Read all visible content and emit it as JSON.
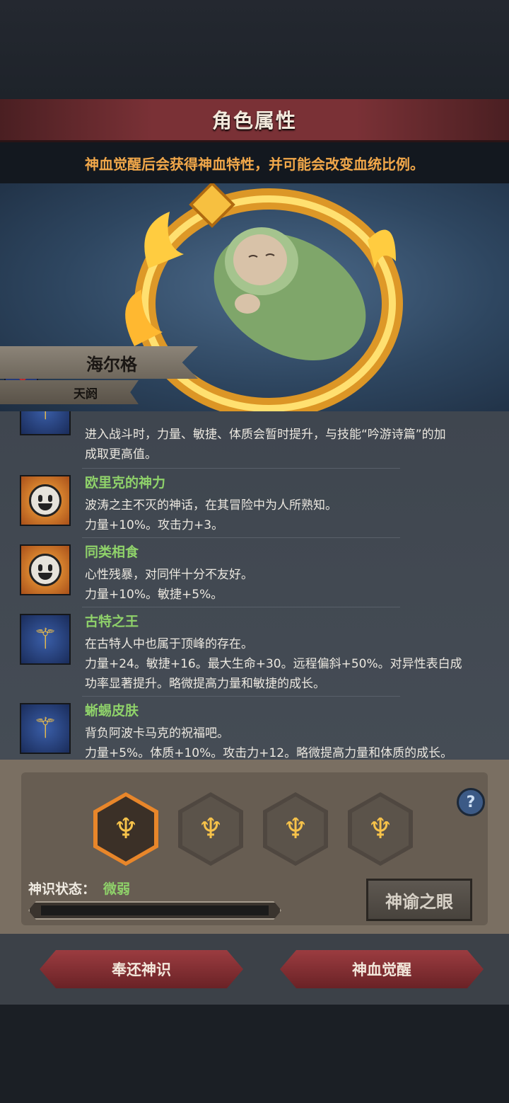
{
  "title": "角色属性",
  "hint": "神血觉醒后会获得神血特性，并可能会改变血统比例。",
  "character": {
    "name": "海尔格",
    "trait_title": "天阏"
  },
  "traits": [
    {
      "name": "",
      "icon": "axe-icon",
      "lines": [
        "进入战斗时，力量、敏捷、体质会暂时提升，与技能“吟游诗篇”的加",
        "成取更高值。"
      ]
    },
    {
      "name": "欧里克的神力",
      "icon": "smiley-face-icon",
      "lines": [
        "波涛之主不灭的神话，在其冒险中为人所熟知。",
        "力量+10%。攻击力+3。"
      ]
    },
    {
      "name": "同类相食",
      "icon": "smiley-face-icon",
      "lines": [
        "心性残暴，对同伴十分不友好。",
        "力量+10%。敏捷+5%。"
      ]
    },
    {
      "name": "古特之王",
      "icon": "axe-icon",
      "lines": [
        "在古特人中也属于顶峰的存在。",
        "力量+24。敏捷+16。最大生命+30。远程偏斜+50%。对异性表白成",
        "功率显著提升。略微提高力量和敏捷的成长。"
      ]
    },
    {
      "name": "蜥蜴皮肤",
      "icon": "axe-icon",
      "lines": [
        "背负阿波卡马克的祝福吧。",
        "力量+5%。体质+10%。攻击力+12。略微提高力量和体质的成长。"
      ]
    }
  ],
  "slots": [
    {
      "state": "active",
      "icon": "flame-trident-icon"
    },
    {
      "state": "inactive",
      "icon": "flame-trident-icon"
    },
    {
      "state": "inactive",
      "icon": "flame-trident-icon"
    },
    {
      "state": "inactive",
      "icon": "flame-trident-icon"
    }
  ],
  "status": {
    "label": "神识状态：",
    "value": "微弱",
    "progress": 0.0
  },
  "buttons": {
    "help": "?",
    "oracle_eye": "神谕之眼",
    "return": "奉还神识",
    "awaken": "神血觉醒"
  },
  "colors": {
    "accent_green": "#8fd26a",
    "hint_orange": "#f2a84a",
    "title_red": "#7a3136"
  }
}
